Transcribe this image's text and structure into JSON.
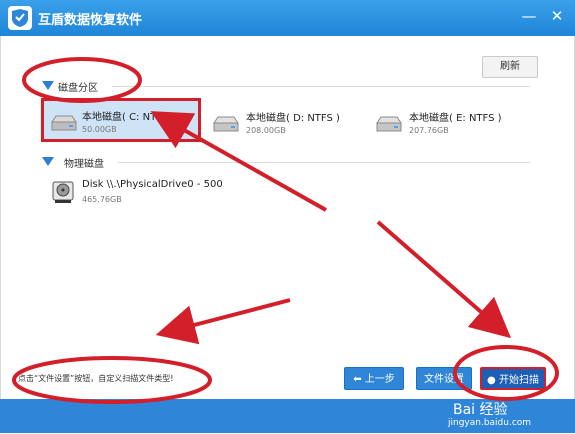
{
  "app": {
    "title": "互盾数据恢复软件"
  },
  "window_controls": {
    "minimize": "—",
    "close": "✕"
  },
  "toolbar": {
    "refresh_label": "刷新"
  },
  "sections": {
    "partition": {
      "label": "磁盘分区"
    },
    "physical": {
      "label": "物理磁盘"
    }
  },
  "partitions": [
    {
      "name": "本地磁盘( C: NTFS )",
      "size": "50.00GB",
      "selected": true
    },
    {
      "name": "本地磁盘( D: NTFS )",
      "size": "208.00GB",
      "selected": false
    },
    {
      "name": "本地磁盘( E: NTFS )",
      "size": "207.76GB",
      "selected": false
    }
  ],
  "physical_disks": [
    {
      "name": "Disk \\\\.\\PhysicalDrive0 - 500",
      "size": "465.76GB"
    }
  ],
  "footer": {
    "hint": "点击“文件设置”按钮，自定义扫描文件类型!",
    "prev_label": "上一步",
    "file_settings_label": "文件设置",
    "start_scan_label": "开始扫描"
  },
  "watermark": {
    "text": "jingyan.baidu.com",
    "brand": "Bai 经验"
  },
  "colors": {
    "titlebar": "#2f86d8",
    "accent": "#2b7fd6",
    "annotation_red": "#d21f2a"
  }
}
